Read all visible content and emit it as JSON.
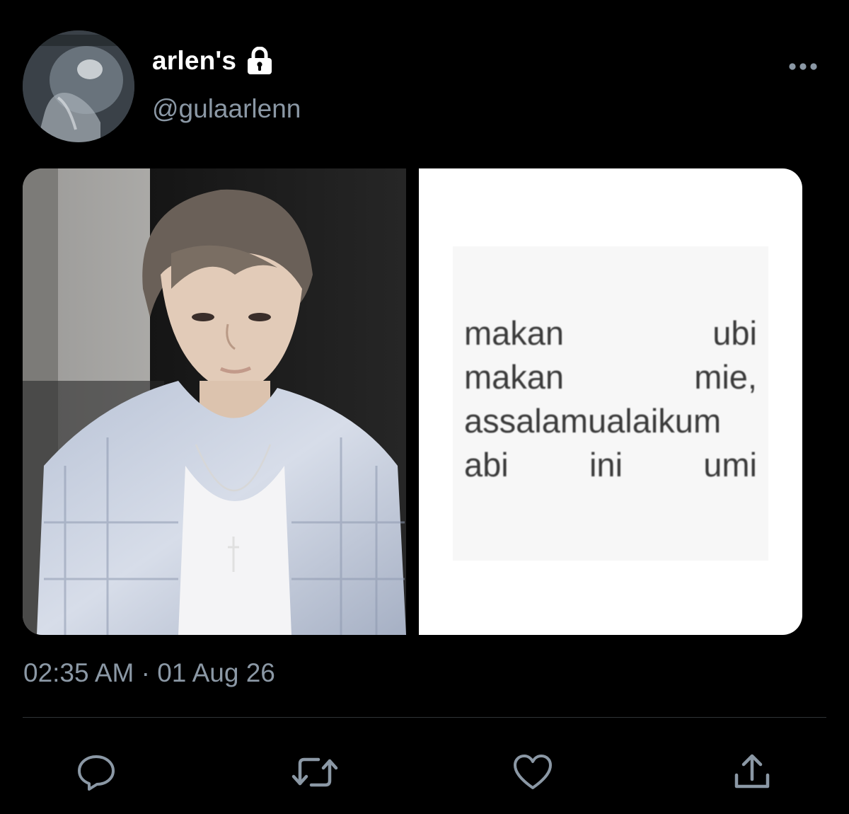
{
  "tweet": {
    "display_name": "arlen's",
    "handle": "@gulaarlenn",
    "timestamp": "02:35 AM · 01 Aug 26",
    "protected_icon": "lock-icon",
    "more_icon": "more-horizontal-icon"
  },
  "media": {
    "photo_icon": "photo-of-person",
    "text_card": {
      "lines": [
        [
          "makan",
          "ubi"
        ],
        [
          "makan",
          "mie,"
        ],
        [
          "assalamualaikum"
        ],
        [
          "abi",
          "ini",
          "umi"
        ]
      ]
    }
  },
  "actions": [
    {
      "icon": "reply-icon"
    },
    {
      "icon": "retweet-icon"
    },
    {
      "icon": "like-icon"
    },
    {
      "icon": "share-icon"
    }
  ],
  "colors": {
    "background": "#000000",
    "secondary_text": "#8b98a5",
    "divider": "#2f3336"
  }
}
